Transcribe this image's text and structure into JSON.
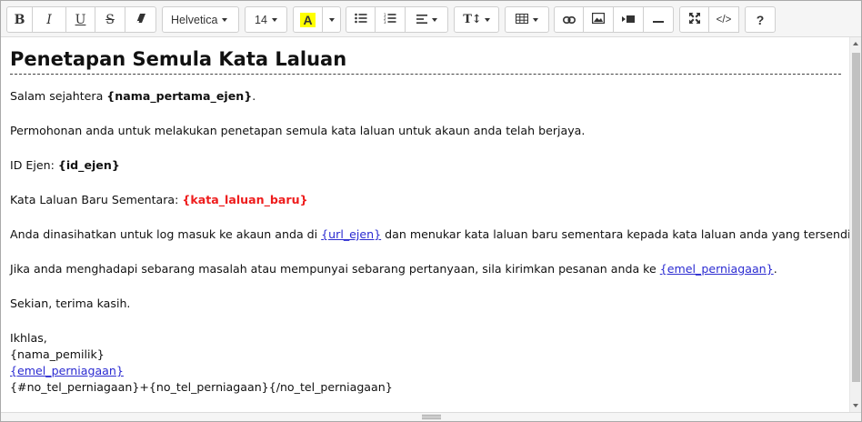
{
  "toolbar": {
    "bold_label": "B",
    "italic_label": "I",
    "underline_label": "U",
    "strike_label": "S",
    "font_family": "Helvetica",
    "font_size": "14",
    "color_label": "A",
    "color_highlight": "#ffff00",
    "line_height_label": "T↕",
    "code_label": "</>",
    "help_label": "?"
  },
  "content": {
    "heading": "Penetapan Semula Kata Laluan",
    "greeting_prefix": "Salam sejahtera ",
    "greeting_var": "{nama_pertama_ejen}",
    "greeting_suffix": ".",
    "p2": "Permohonan anda untuk melakukan penetapan semula kata laluan untuk akaun anda telah berjaya.",
    "id_label": "ID Ejen: ",
    "id_var": "{id_ejen}",
    "pw_label": "Kata Laluan Baru Sementara: ",
    "pw_var": "{kata_laluan_baru}",
    "p5_prefix": "Anda dinasihatkan untuk log masuk ke akaun anda di ",
    "p5_link": "{url_ejen}",
    "p5_suffix": " dan menukar kata laluan baru sementara kepada kata laluan anda yang tersendiri.",
    "p6_prefix": "Jika anda menghadapi sebarang masalah atau mempunyai sebarang pertanyaan, sila kirimkan pesanan anda ke ",
    "p6_link": "{emel_perniagaan}",
    "p6_suffix": ".",
    "p7": "Sekian, terima kasih.",
    "sign_1": "Ikhlas,",
    "sign_2": "{nama_pemilik}",
    "sign_3": "{emel_perniagaan}",
    "sign_4": "{#no_tel_perniagaan}+{no_tel_perniagaan}{/no_tel_perniagaan}"
  },
  "colors": {
    "accent_red": "#ee1c1c",
    "link_blue": "#2b2bd1"
  }
}
